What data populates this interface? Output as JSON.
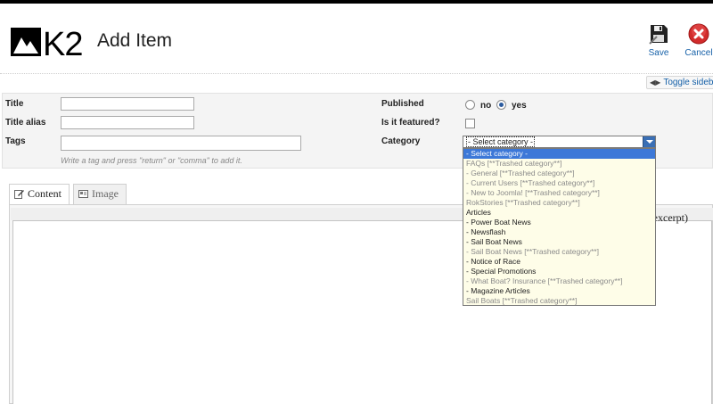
{
  "header": {
    "title": "Add Item",
    "save_label": "Save",
    "cancel_label": "Cancel",
    "toggle_sidebar_label": "Toggle sideba"
  },
  "form": {
    "title_label": "Title",
    "title_value": "",
    "alias_label": "Title alias",
    "alias_value": "",
    "tags_label": "Tags",
    "tags_value": "",
    "tags_hint": "Write a tag and press \"return\" or \"comma\" to add it.",
    "published_label": "Published",
    "published_no": "no",
    "published_yes": "yes",
    "published_value": "yes",
    "featured_label": "Is it featured?",
    "featured_checked": false,
    "category_label": "Category",
    "category_selected": "- Select category -"
  },
  "category_options": [
    {
      "label": "- Select category -",
      "state": "selected"
    },
    {
      "label": "FAQs [**Trashed category**]",
      "state": "trashed"
    },
    {
      "label": "- General [**Trashed category**]",
      "state": "trashed"
    },
    {
      "label": "- Current Users [**Trashed category**]",
      "state": "trashed"
    },
    {
      "label": "- New to Joomla! [**Trashed category**]",
      "state": "trashed"
    },
    {
      "label": "RokStories [**Trashed category**]",
      "state": "trashed"
    },
    {
      "label": "Articles",
      "state": "normal"
    },
    {
      "label": "- Power Boat News",
      "state": "normal"
    },
    {
      "label": "- Newsflash",
      "state": "normal"
    },
    {
      "label": "- Sail Boat News",
      "state": "normal"
    },
    {
      "label": "- Sail Boat News [**Trashed category**]",
      "state": "trashed"
    },
    {
      "label": "- Notice of Race",
      "state": "normal"
    },
    {
      "label": "- Special Promotions",
      "state": "normal"
    },
    {
      "label": "- What Boat? Insurance [**Trashed category**]",
      "state": "trashed"
    },
    {
      "label": "- Magazine Articles",
      "state": "normal"
    },
    {
      "label": "Sail Boats [**Trashed category**]",
      "state": "trashed"
    }
  ],
  "tabs": {
    "content_label": "Content",
    "image_label": "Image"
  },
  "editor": {
    "excerpt_label": "t/excerpt)"
  },
  "icons": {
    "logo": "k2-logo",
    "save": "floppy-disk-icon",
    "cancel": "cancel-icon",
    "toggle": "left-right-arrows-icon",
    "content_tab": "edit-icon",
    "image_tab": "image-icon"
  },
  "colors": {
    "link": "#1560a8",
    "selected_option": "#3c78d8",
    "dropdown_bg": "#fefde8",
    "cancel_red": "#d22b2b"
  }
}
